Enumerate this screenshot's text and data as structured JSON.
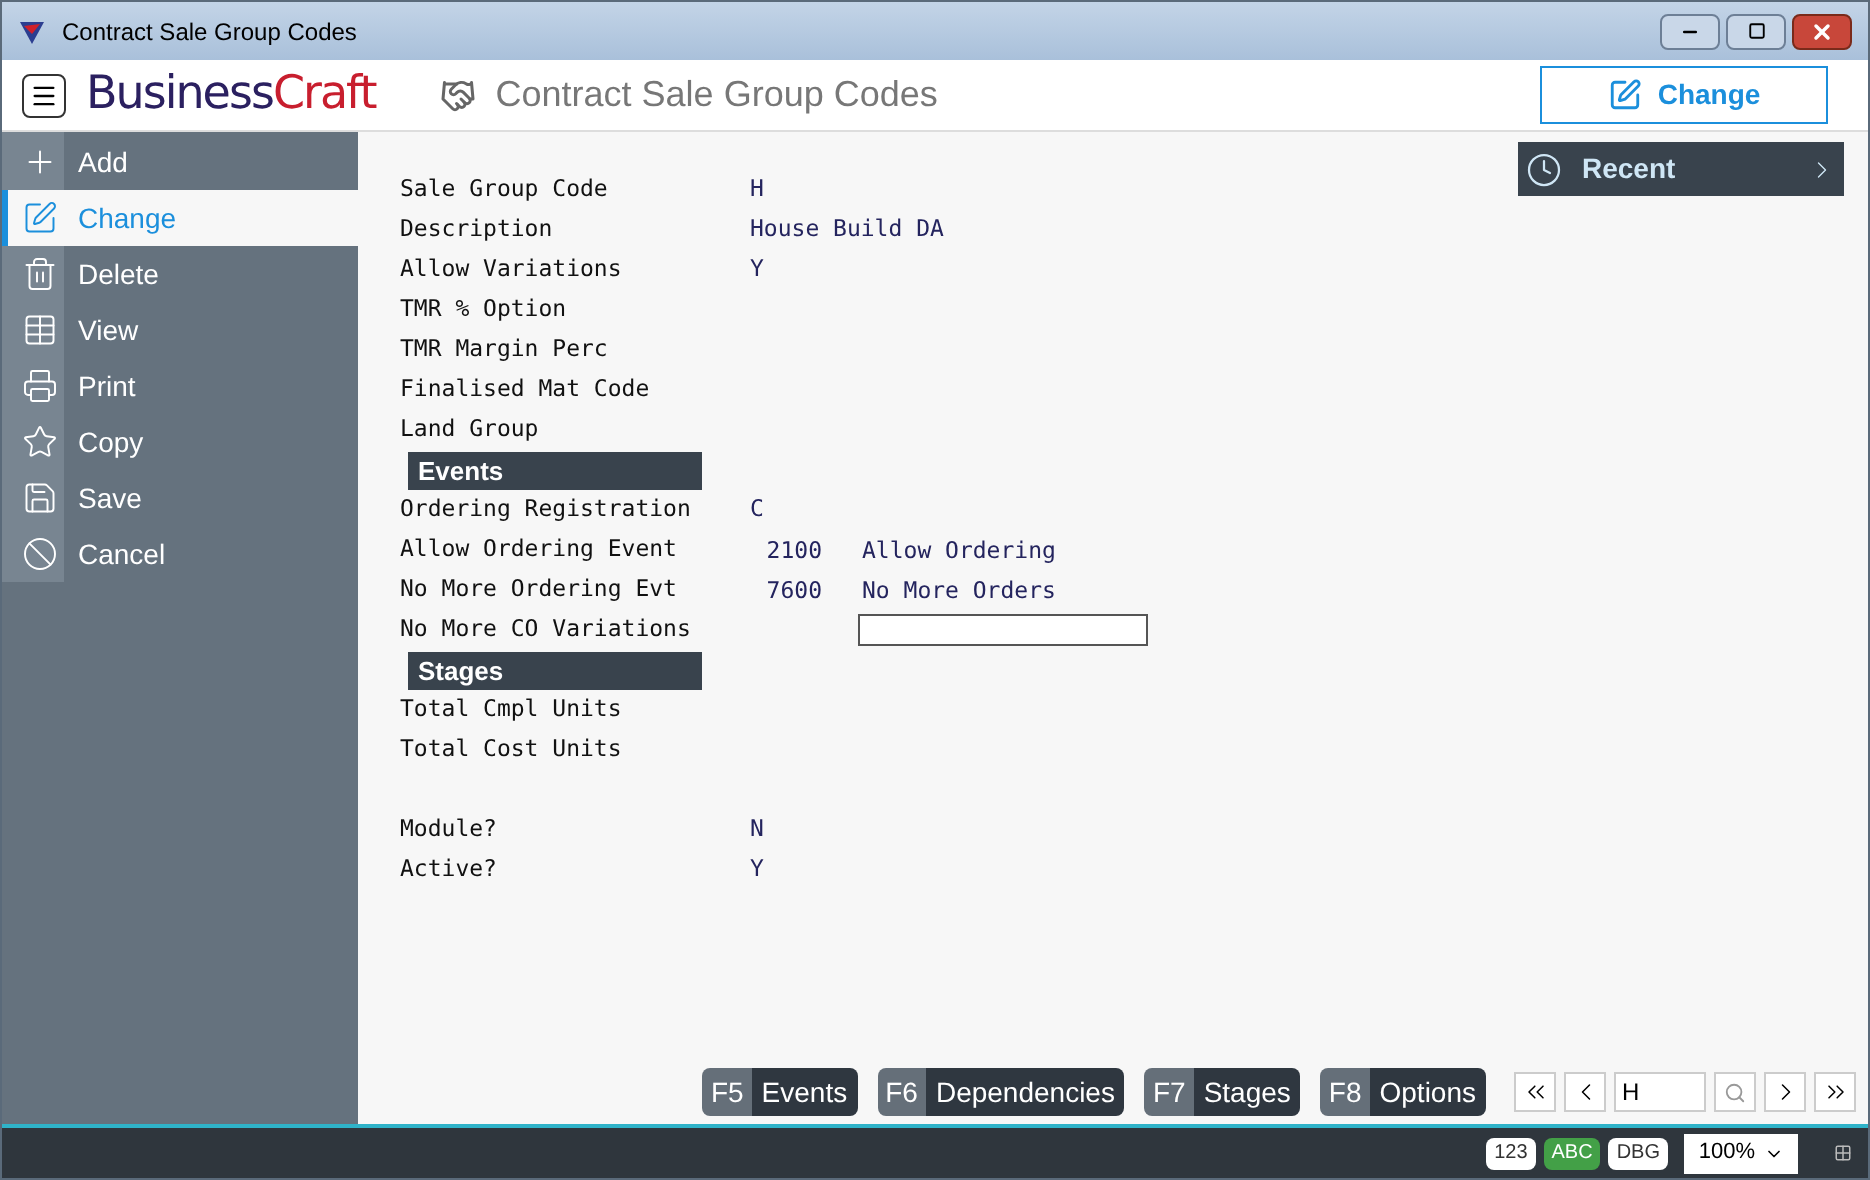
{
  "window": {
    "title": "Contract Sale Group Codes"
  },
  "header": {
    "brand_dark": "Business",
    "brand_accent": "Craft",
    "page_title": "Contract Sale Group Codes",
    "mode_button": "Change"
  },
  "sidebar": {
    "items": [
      {
        "label": "Add",
        "selected": false
      },
      {
        "label": "Change",
        "selected": true
      },
      {
        "label": "Delete",
        "selected": false
      },
      {
        "label": "View",
        "selected": false
      },
      {
        "label": "Print",
        "selected": false
      },
      {
        "label": "Copy",
        "selected": false
      },
      {
        "label": "Save",
        "selected": false
      },
      {
        "label": "Cancel",
        "selected": false
      }
    ]
  },
  "fields": [
    {
      "label": "Sale Group Code",
      "value": "H"
    },
    {
      "label": "Description",
      "value": "House Build DA"
    },
    {
      "label": "Allow Variations",
      "value": "Y"
    },
    {
      "label": "TMR % Option"
    },
    {
      "label": "TMR Margin Perc"
    },
    {
      "label": "Finalised Mat Code"
    },
    {
      "label": "Land Group"
    }
  ],
  "events": {
    "title": "Events",
    "rows": [
      {
        "kind": "value",
        "label": "Ordering Registration",
        "value": "C"
      },
      {
        "kind": "event",
        "label": "Allow Ordering Event",
        "code": "2100",
        "description": "Allow Ordering"
      },
      {
        "kind": "event",
        "label": "No More Ordering Evt",
        "code": "7600",
        "description": "No More Orders"
      },
      {
        "kind": "input",
        "label": "No More CO Variations"
      }
    ]
  },
  "stages": {
    "title": "Stages",
    "rows": [
      {
        "label": "Total Cmpl Units"
      },
      {
        "label": "Total Cost Units"
      }
    ]
  },
  "flags": [
    {
      "label": "Module?",
      "value": "N"
    },
    {
      "label": "Active?",
      "value": "Y"
    }
  ],
  "recent": {
    "label": "Recent"
  },
  "function_keys": [
    {
      "key": "F5",
      "label": "Events"
    },
    {
      "key": "F6",
      "label": "Dependencies"
    },
    {
      "key": "F7",
      "label": "Stages"
    },
    {
      "key": "F8",
      "label": "Options"
    }
  ],
  "navigator": {
    "value": "H"
  },
  "status_bar": {
    "toggles": [
      {
        "label": "123",
        "on": false
      },
      {
        "label": "ABC",
        "on": true
      },
      {
        "label": "DBG",
        "on": false
      }
    ],
    "zoom": "100%"
  }
}
